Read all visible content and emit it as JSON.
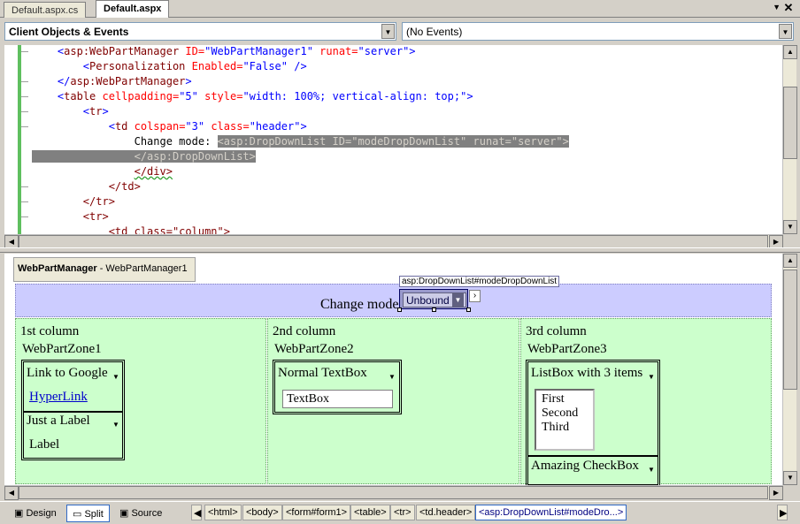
{
  "tabs": [
    {
      "label": "Default.aspx.cs",
      "active": false
    },
    {
      "label": "Default.aspx",
      "active": true
    }
  ],
  "objects_combo": {
    "value": "Client Objects & Events"
  },
  "events_combo": {
    "value": "(No Events)"
  },
  "code": {
    "lines": [
      [
        "    ",
        "",
        "<",
        "asp:WebPartManager",
        " ID=",
        "\"WebPartManager1\"",
        " runat=",
        "\"server\"",
        ">"
      ],
      [
        "        ",
        "",
        "<",
        "Personalization",
        " Enabled=",
        "\"False\"",
        " />",
        "",
        ""
      ],
      [
        "    ",
        "",
        "</",
        "asp:WebPartManager",
        ">",
        "",
        "",
        "",
        ""
      ],
      [
        "    ",
        "",
        "<",
        "table",
        " cellpadding=",
        "\"5\"",
        " style=",
        "\"width: 100%; vertical-align: top;\"",
        ">"
      ],
      [
        "        ",
        "",
        "<",
        "tr",
        ">",
        "",
        "",
        "",
        ""
      ],
      [
        "            ",
        "",
        "<",
        "td",
        " colspan=",
        "\"3\"",
        " class=",
        "\"header\"",
        ">"
      ]
    ],
    "change_mode_text": "Change mode: ",
    "selected_line1": "<asp:DropDownList ID=\"modeDropDownList\" runat=\"server\">",
    "selected_line2": "    </asp:DropDownList>",
    "div_close": "</div>",
    "td_close": "</td>",
    "tr_close": "</tr>",
    "tr_open": "<tr>",
    "td_column": "<td class=\"column\">"
  },
  "design": {
    "web_part_manager_bold": "WebPartManager",
    "web_part_manager_id": " - WebPartManager1",
    "change_mode_label": "Change mode:",
    "ddl_tag_label": "asp:DropDownList#modeDropDownList",
    "ddl_value": "Unbound",
    "columns": [
      {
        "title": "1st column",
        "zone": "WebPartZone1",
        "parts": [
          {
            "title": "Link to Google",
            "content": "HyperLink"
          },
          {
            "title": "Just a Label",
            "content": "Label"
          }
        ]
      },
      {
        "title": "2nd column",
        "zone": "WebPartZone2",
        "parts": [
          {
            "title": "Normal TextBox",
            "content": "TextBox"
          }
        ]
      },
      {
        "title": "3rd column",
        "zone": "WebPartZone3",
        "parts": [
          {
            "title": "ListBox with 3 items",
            "items": [
              "First",
              "Second",
              "Third"
            ]
          },
          {
            "title": "Amazing CheckBox",
            "content": ""
          }
        ]
      }
    ]
  },
  "bottom": {
    "views": [
      {
        "label": "Design",
        "active": false
      },
      {
        "label": "Split",
        "active": true
      },
      {
        "label": "Source",
        "active": false
      }
    ],
    "crumbs": [
      "<html>",
      "<body>",
      "<form#form1>",
      "<table>",
      "<tr>",
      "<td.header>",
      "<asp:DropDownList#modeDro...>"
    ]
  }
}
